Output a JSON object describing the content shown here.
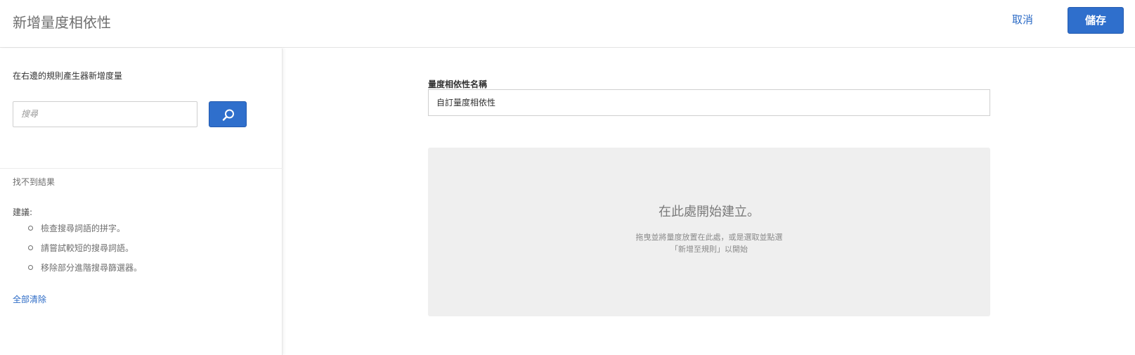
{
  "header": {
    "title": "新增量度相依性",
    "cancel_label": "取消",
    "save_label": "儲存"
  },
  "sidebar": {
    "heading": "在右邊的規則產生器新增度量",
    "search": {
      "placeholder": "搜尋",
      "value": ""
    },
    "no_results": "找不到結果",
    "suggestions_label": "建議:",
    "suggestions": [
      "檢查搜尋詞語的拼字。",
      "請嘗試較短的搜尋詞語。",
      "移除部分進階搜尋篩選器。"
    ],
    "clear_all": "全部清除"
  },
  "main": {
    "field_label": "量度相依性名稱",
    "field_value": "自訂量度相依性",
    "drop_zone": {
      "title": "在此處開始建立。",
      "hint_line1": "拖曳並將量度放置在此處，或是選取並點選",
      "hint_line2": "「新增至規則」以開始"
    }
  },
  "colors": {
    "accent": "#2f6fcc",
    "link": "#2c6bc6",
    "drop_zone_bg": "#efefef"
  }
}
